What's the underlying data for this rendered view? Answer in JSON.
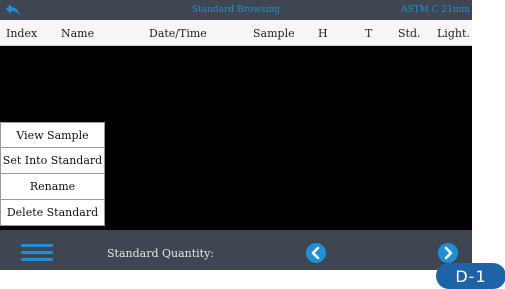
{
  "topbar": {
    "title": "Standard Browsing",
    "standard": "ASTM C 21mm",
    "back_icon": "back-arrow-icon"
  },
  "columns": [
    "Index",
    "Name",
    "Date/Time",
    "Sample",
    "H",
    "T",
    "Std.",
    "Light."
  ],
  "context_menu": {
    "items": [
      "View Sample",
      "Set Into Standard",
      "Rename",
      "Delete Standard"
    ]
  },
  "bottombar": {
    "menu_icon": "hamburger-menu-icon",
    "quantity_label": "Standard Quantity:",
    "prev_icon": "chevron-left-icon",
    "next_icon": "chevron-right-icon"
  },
  "tag": "D-1",
  "colors": {
    "bar": "#3f4652",
    "accent": "#1f8fd6",
    "tag": "#1e63a8"
  }
}
